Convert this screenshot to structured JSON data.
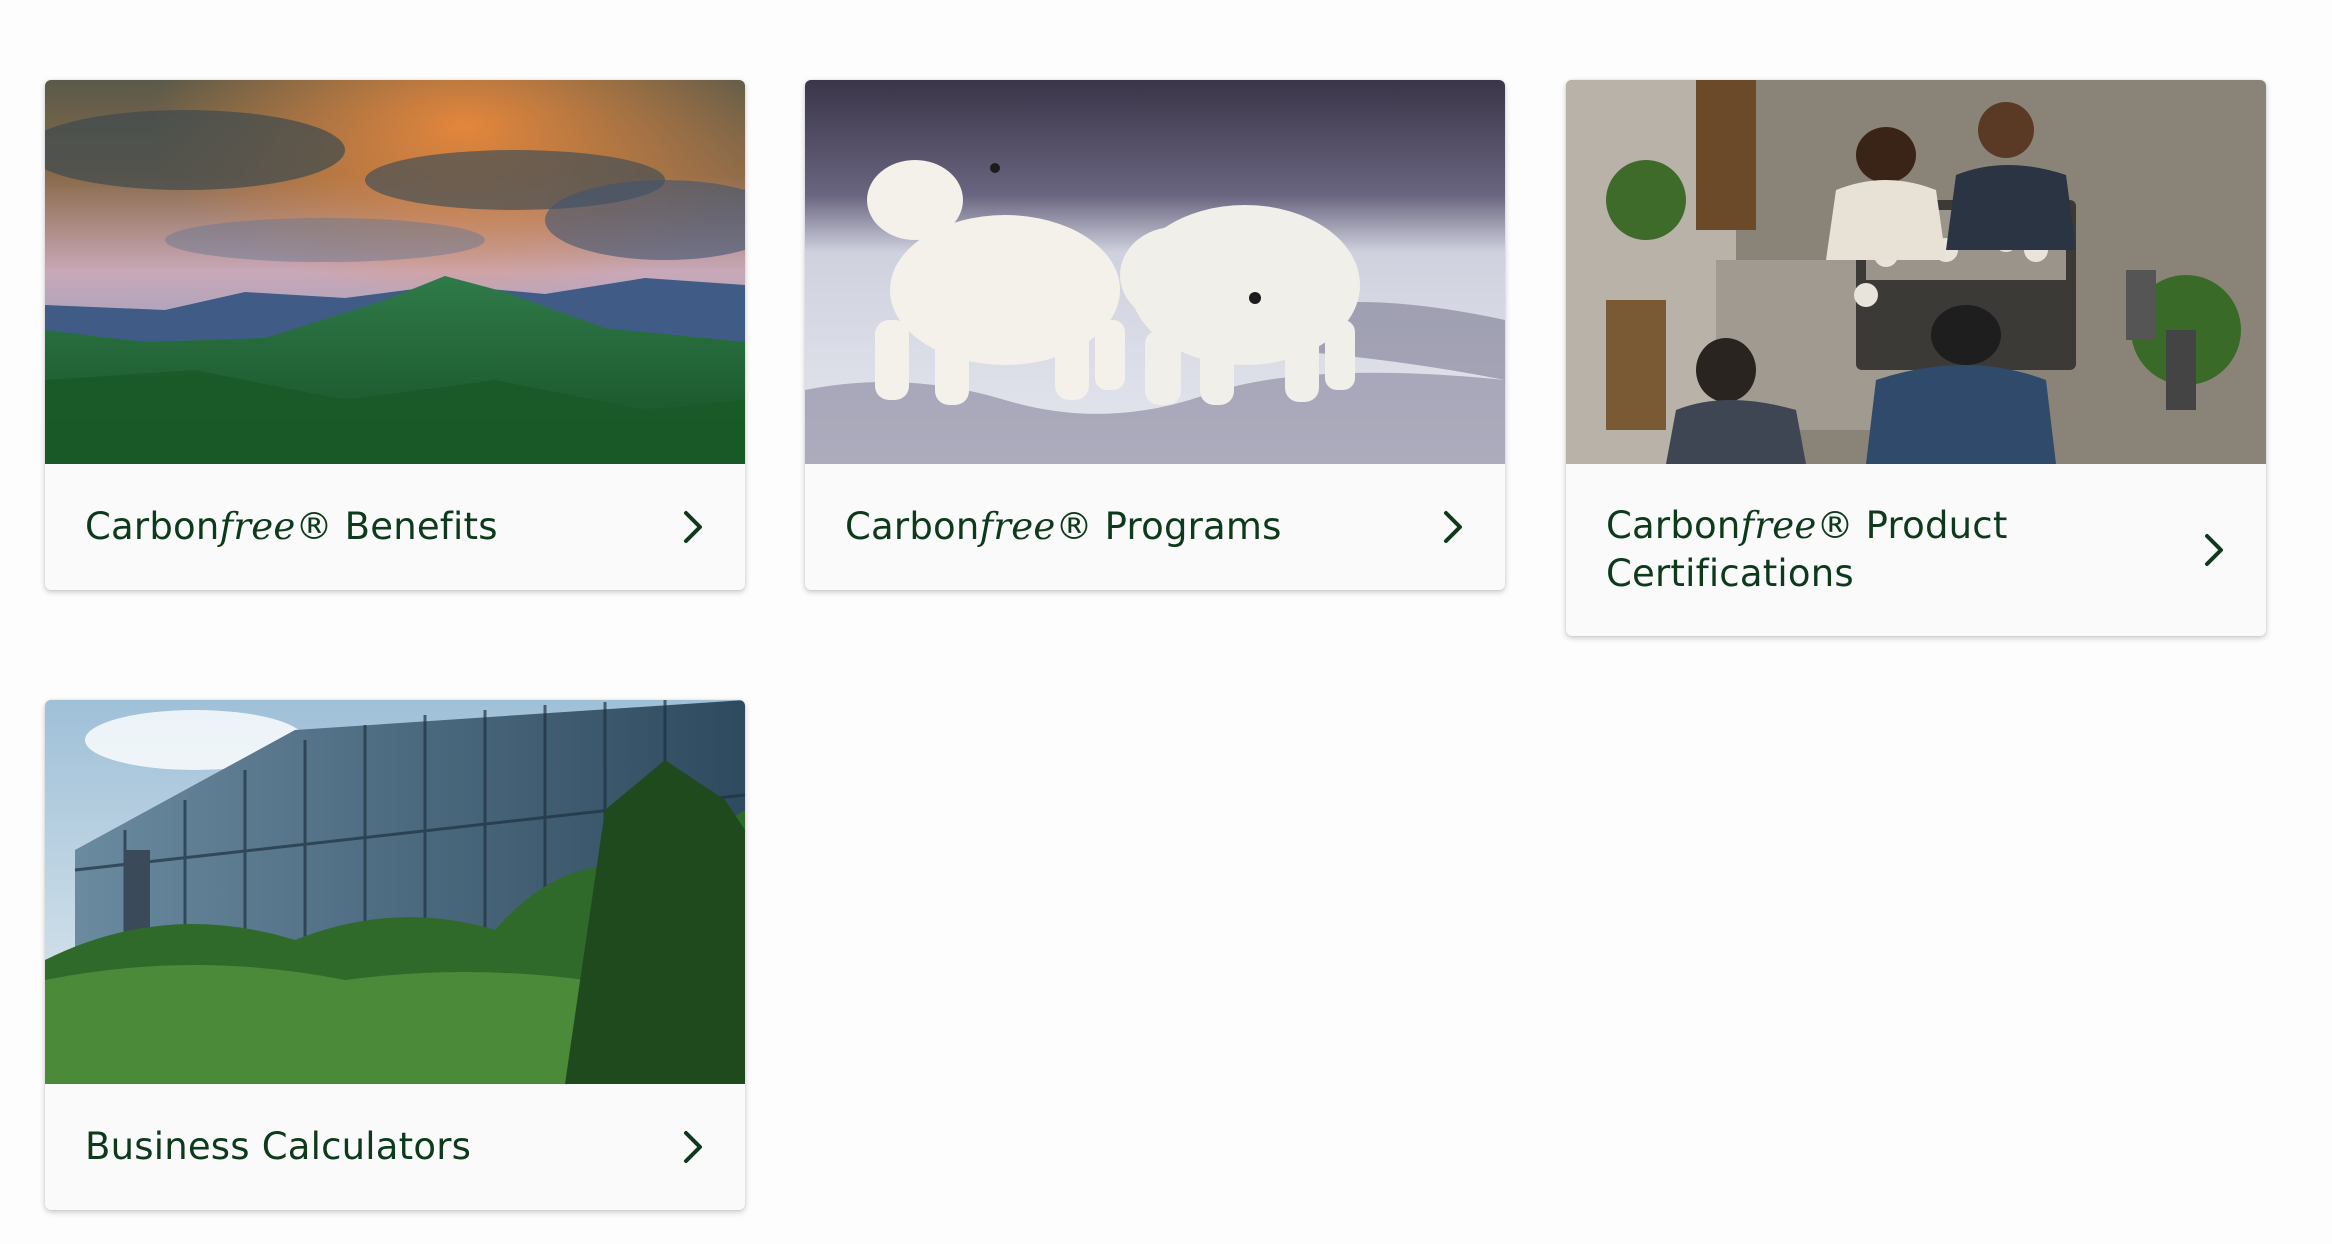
{
  "cards": [
    {
      "title_pre": "Carbon",
      "title_em": "free",
      "title_post": "® Benefits",
      "image": "mountain-forest-sunset-photo",
      "icon": "chevron-right-icon"
    },
    {
      "title_pre": "Carbon",
      "title_em": "free",
      "title_post": "® Programs",
      "image": "polar-bears-photo",
      "icon": "chevron-right-icon"
    },
    {
      "title_pre": "Carbon",
      "title_em": "free",
      "title_post": "® Product Certifications",
      "image": "cafe-baristas-photo",
      "icon": "chevron-right-icon"
    },
    {
      "title_pre": "Business Calculators",
      "title_em": "",
      "title_post": "",
      "image": "glass-office-building-photo",
      "icon": "chevron-right-icon"
    }
  ],
  "colors": {
    "title": "#0c3a1a",
    "card_bg": "#fafafa",
    "page_bg": "#fdfdfd"
  }
}
